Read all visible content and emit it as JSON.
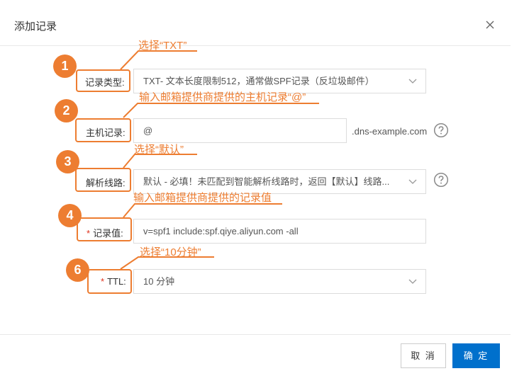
{
  "dialog": {
    "title": "添加记录"
  },
  "fields": {
    "record_type": {
      "label": "记录类型:",
      "value": "TXT- 文本长度限制512，通常做SPF记录（反垃圾邮件）"
    },
    "host": {
      "label": "主机记录:",
      "value": "@",
      "suffix": ".dns-example.com"
    },
    "line": {
      "label": "解析线路:",
      "value": "默认 - 必填！未匹配到智能解析线路时，返回【默认】线路..."
    },
    "record_value": {
      "required_mark": "*",
      "label": "记录值:",
      "value": "v=spf1 include:spf.qiye.aliyun.com -all"
    },
    "ttl": {
      "required_mark": "*",
      "label": "TTL:",
      "value": "10 分钟"
    }
  },
  "annotations": {
    "steps": [
      {
        "number": "1",
        "note": "选择“TXT”"
      },
      {
        "number": "2",
        "note": "输入邮箱提供商提供的主机记录“@”"
      },
      {
        "number": "3",
        "note": "选择“默认”"
      },
      {
        "number": "4",
        "note": "输入邮箱提供商提供的记录值"
      },
      {
        "number": "6",
        "note": "选择“10分钟”"
      }
    ]
  },
  "footer": {
    "cancel_label": "取 消",
    "ok_label": "确 定"
  },
  "colors": {
    "accent": "#ed7d31",
    "primary": "#0070cc"
  },
  "icons": {
    "close": "close-icon",
    "chevron": "chevron-down-icon",
    "help": "help-circle-icon"
  }
}
